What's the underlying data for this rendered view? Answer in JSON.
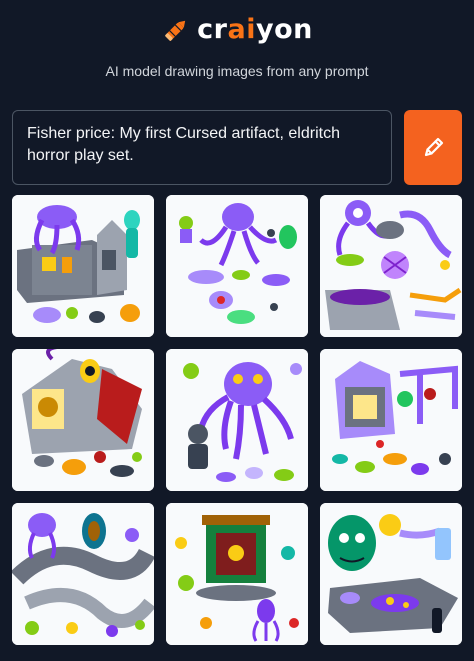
{
  "header": {
    "logo_prefix": "cr",
    "logo_accent": "ai",
    "logo_suffix": "yon",
    "tagline": "AI model drawing images from any prompt",
    "icon": "crayon-icon"
  },
  "prompt": {
    "value": "Fisher price: My first Cursed artifact, eldritch horror play set.",
    "button_icon": "pencil-icon"
  },
  "results": {
    "images": [
      {
        "id": "result-image-1"
      },
      {
        "id": "result-image-2"
      },
      {
        "id": "result-image-3"
      },
      {
        "id": "result-image-4"
      },
      {
        "id": "result-image-5"
      },
      {
        "id": "result-image-6"
      },
      {
        "id": "result-image-7"
      },
      {
        "id": "result-image-8"
      },
      {
        "id": "result-image-9"
      }
    ]
  },
  "colors": {
    "background": "#111827",
    "accent": "#f4621f",
    "toy_purple": "#8b5cf6",
    "toy_green": "#84cc16",
    "toy_grey": "#6b7280"
  }
}
